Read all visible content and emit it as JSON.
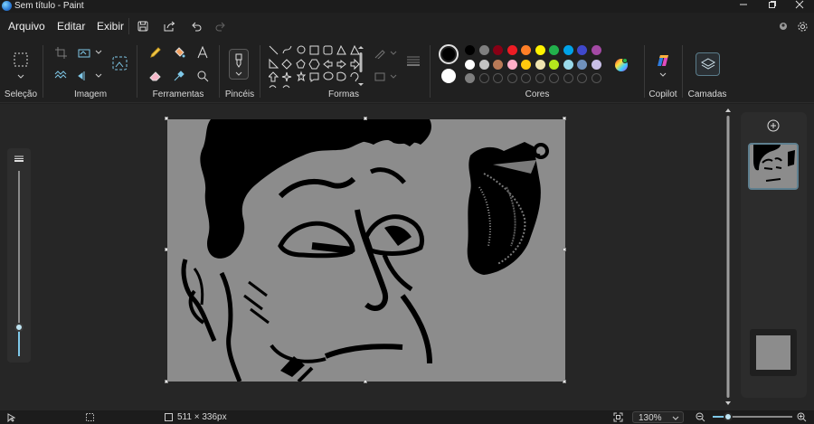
{
  "window": {
    "title": "Sem título - Paint",
    "controls": [
      "minimize-icon",
      "maximize-icon",
      "close-icon"
    ]
  },
  "menu": {
    "file": "Arquivo",
    "edit": "Editar",
    "view": "Exibir"
  },
  "ribbon": {
    "groups": {
      "selection": "Seleção",
      "image": "Imagem",
      "tools": "Ferramentas",
      "brushes": "Pincéis",
      "shapes": "Formas",
      "colors": "Cores",
      "copilot": "Copilot",
      "layers": "Camadas"
    },
    "palette": {
      "row1": [
        "#000000",
        "#7f7f7f",
        "#880015",
        "#ed1c24",
        "#ff7f27",
        "#fff200",
        "#22b14c",
        "#00a2e8",
        "#3f48cc",
        "#a349a4"
      ],
      "row2": [
        "#ffffff",
        "#c3c3c3",
        "#b97a57",
        "#ffaec9",
        "#ffc90e",
        "#efe4b0",
        "#b5e61d",
        "#99d9ea",
        "#7092be",
        "#c8bfe7"
      ],
      "row3_first": "#7f7f7f",
      "primary": "#000000",
      "secondary": "#ffffff"
    }
  },
  "status": {
    "canvas_size": "511 × 336px",
    "zoom": "130%"
  }
}
